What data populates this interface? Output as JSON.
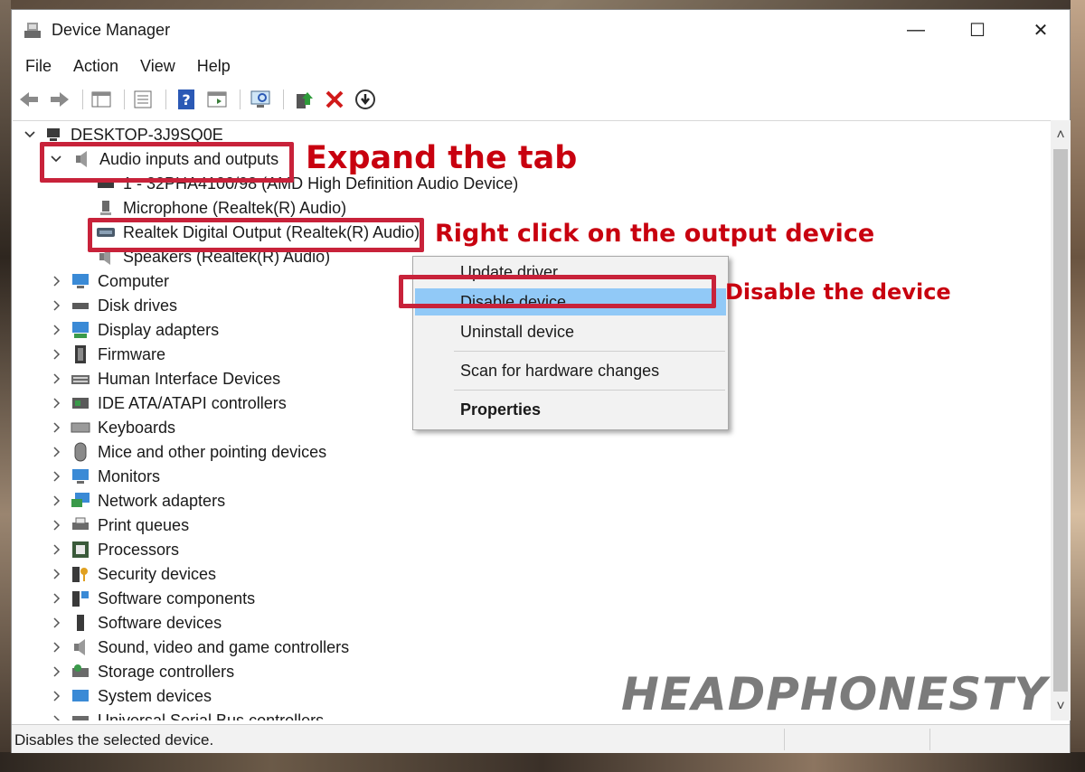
{
  "window": {
    "title": "Device Manager",
    "controls": {
      "minimize": "—",
      "maximize": "☐",
      "close": "✕"
    }
  },
  "menu": [
    "File",
    "Action",
    "View",
    "Help"
  ],
  "toolbar": {
    "icons": [
      "back-arrow-icon",
      "forward-arrow-icon",
      "properties-grid-icon",
      "properties-sheet-icon",
      "help-icon",
      "action-pane-icon",
      "monitor-scan-icon",
      "update-driver-icon",
      "uninstall-x-icon",
      "disable-download-icon"
    ]
  },
  "tree": {
    "root": "DESKTOP-3J9SQ0E",
    "audio_group": "Audio inputs and outputs",
    "audio_children": [
      "1 - 32PHA4100/98 (AMD High Definition Audio Device)",
      "Microphone (Realtek(R) Audio)",
      "Realtek Digital Output (Realtek(R) Audio)",
      "Speakers (Realtek(R) Audio)"
    ],
    "categories": [
      "Computer",
      "Disk drives",
      "Display adapters",
      "Firmware",
      "Human Interface Devices",
      "IDE ATA/ATAPI controllers",
      "Keyboards",
      "Mice and other pointing devices",
      "Monitors",
      "Network adapters",
      "Print queues",
      "Processors",
      "Security devices",
      "Software components",
      "Software devices",
      "Sound, video and game controllers",
      "Storage controllers",
      "System devices",
      "Universal Serial Bus controllers"
    ]
  },
  "context_menu": {
    "items": [
      "Update driver",
      "Disable device",
      "Uninstall device",
      "Scan for hardware changes",
      "Properties"
    ]
  },
  "status": {
    "text": "Disables the selected device."
  },
  "annotations": {
    "expand": "Expand the tab",
    "right_click": "Right click on the output device",
    "disable": "Disable the device",
    "accent_color": "#c8223a"
  },
  "watermark": "HEADPHONESTY"
}
